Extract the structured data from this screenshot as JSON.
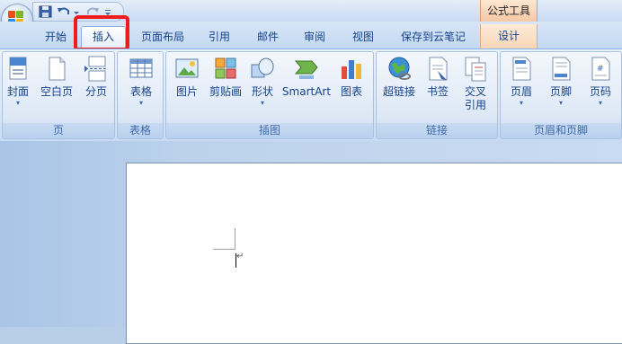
{
  "window": {
    "contextual_tool": "公式工具"
  },
  "tabs": [
    {
      "label": "开始"
    },
    {
      "label": "插入"
    },
    {
      "label": "页面布局"
    },
    {
      "label": "引用"
    },
    {
      "label": "邮件"
    },
    {
      "label": "审阅"
    },
    {
      "label": "视图"
    },
    {
      "label": "保存到云笔记"
    },
    {
      "label": "设计"
    }
  ],
  "active_tab": "插入",
  "groups": {
    "pages": {
      "label": "页",
      "buttons": [
        {
          "label": "封面",
          "icon": "cover-page-icon"
        },
        {
          "label": "空白页",
          "icon": "blank-page-icon"
        },
        {
          "label": "分页",
          "icon": "page-break-icon"
        }
      ]
    },
    "tables": {
      "label": "表格",
      "buttons": [
        {
          "label": "表格",
          "icon": "table-icon"
        }
      ]
    },
    "illustrations": {
      "label": "插图",
      "buttons": [
        {
          "label": "图片",
          "icon": "picture-icon"
        },
        {
          "label": "剪贴画",
          "icon": "clip-art-icon"
        },
        {
          "label": "形状",
          "icon": "shapes-icon"
        },
        {
          "label": "SmartArt",
          "icon": "smartart-icon"
        },
        {
          "label": "图表",
          "icon": "chart-icon"
        }
      ]
    },
    "links": {
      "label": "链接",
      "buttons": [
        {
          "label": "超链接",
          "icon": "hyperlink-icon"
        },
        {
          "label": "书签",
          "icon": "bookmark-icon"
        },
        {
          "label": "交叉\n引用",
          "label_line1": "交叉",
          "label_line2": "引用",
          "icon": "cross-reference-icon"
        }
      ]
    },
    "header_footer": {
      "label": "页眉和页脚",
      "buttons": [
        {
          "label": "页眉",
          "icon": "header-icon"
        },
        {
          "label": "页脚",
          "icon": "footer-icon"
        },
        {
          "label": "页码",
          "icon": "page-number-icon"
        }
      ]
    }
  },
  "colors": {
    "highlight": "#ee1c1c",
    "ribbon_text": "#15428b",
    "context_tab": "#f6c7a5"
  }
}
